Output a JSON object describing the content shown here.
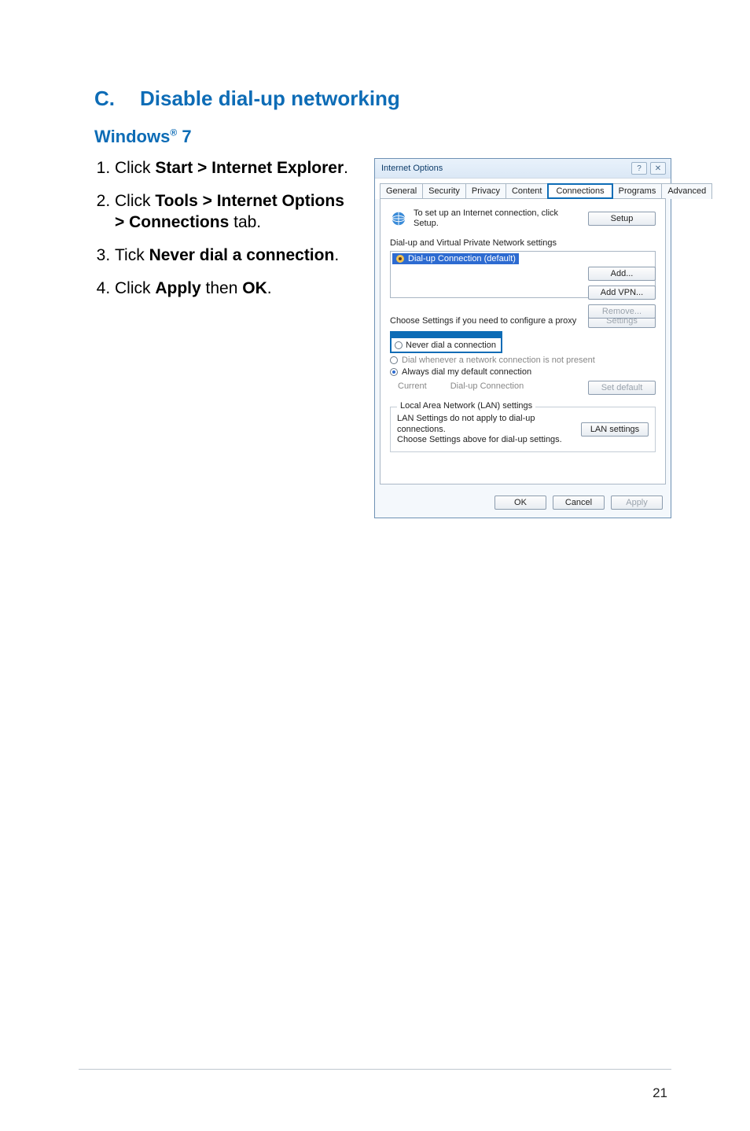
{
  "section": {
    "letter": "C.",
    "title": "Disable dial-up networking"
  },
  "subheading": {
    "os": "Windows",
    "reg": "®",
    "ver": " 7"
  },
  "steps": [
    {
      "pre": "Click ",
      "bold": "Start > Internet Explorer",
      "post": "."
    },
    {
      "pre": "Click ",
      "bold": "Tools > Internet Options > Connections",
      "post": " tab."
    },
    {
      "pre": "Tick ",
      "bold": "Never dial a connection",
      "post": "."
    },
    {
      "pre": "Click ",
      "bold": "Apply",
      "mid": " then ",
      "bold2": "OK",
      "post": "."
    }
  ],
  "dialog": {
    "title": "Internet Options",
    "help_glyph": "?",
    "close_glyph": "✕",
    "tabs": [
      "General",
      "Security",
      "Privacy",
      "Content",
      "Connections",
      "Programs",
      "Advanced"
    ],
    "setup_text_line1": "To set up an Internet connection, click",
    "setup_text_line2": "Setup.",
    "setup_btn": "Setup",
    "dialup_label": "Dial-up and Virtual Private Network settings",
    "list_item": "Dial-up Connection (default)",
    "add_btn": "Add...",
    "addvpn_btn": "Add VPN...",
    "remove_btn": "Remove...",
    "proxy_text": "Choose Settings if you need to configure a proxy",
    "settings_btn": "Settings",
    "never_label": "Never dial a connection",
    "dial_whenever": "Dial whenever a network connection is not present",
    "always_dial": "Always dial my default connection",
    "current_label": "Current",
    "current_value": "Dial-up Connection",
    "setdefault_btn": "Set default",
    "lan_legend": "Local Area Network (LAN) settings",
    "lan_text_line1": "LAN Settings do not apply to dial-up connections.",
    "lan_text_line2": "Choose Settings above for dial-up settings.",
    "lan_btn": "LAN settings",
    "ok_btn": "OK",
    "cancel_btn": "Cancel",
    "apply_btn": "Apply"
  },
  "page_number": "21"
}
